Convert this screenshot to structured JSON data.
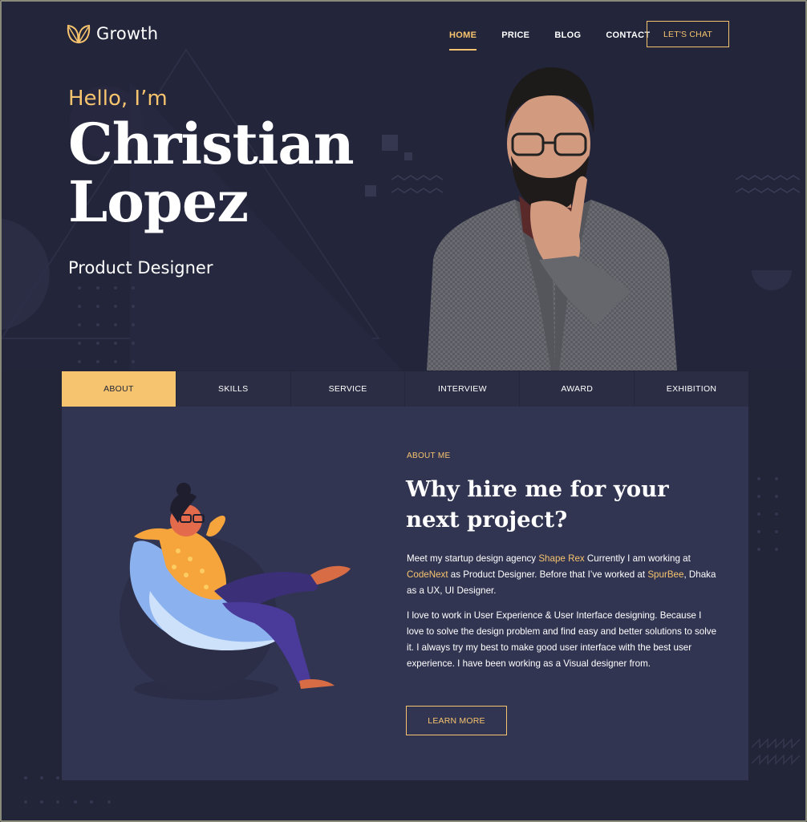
{
  "brand": {
    "logo_text": "Growth",
    "logo_icon": "leaf-icon",
    "accent_color": "#f6c46e",
    "background_color": "#222437",
    "panel_color": "#323552"
  },
  "nav": {
    "items": [
      {
        "label": "HOME",
        "active": true
      },
      {
        "label": "PRICE",
        "active": false
      },
      {
        "label": "BLOG",
        "active": false
      },
      {
        "label": "CONTACT",
        "active": false
      }
    ],
    "cta_label": "LET'S CHAT"
  },
  "hero": {
    "greeting": "Hello, I’m",
    "first_name": "Christian",
    "last_name": "Lopez",
    "role": "Product Designer",
    "portrait": "man-with-beard-portrait"
  },
  "tabs": [
    {
      "label": "ABOUT",
      "active": true
    },
    {
      "label": "SKILLS",
      "active": false
    },
    {
      "label": "SERVICE",
      "active": false
    },
    {
      "label": "INTERVIEW",
      "active": false
    },
    {
      "label": "AWARD",
      "active": false
    },
    {
      "label": "EXHIBITION",
      "active": false
    }
  ],
  "about": {
    "label": "ABOUT ME",
    "title": "Why hire me for your next project?",
    "para1": {
      "t1": "Meet my startup design agency ",
      "link1": "Shape Rex",
      "t2": " Currently I am working at ",
      "link2": "CodeNext",
      "t3": " as Product Designer. Before that I’ve worked at ",
      "link3": "SpurBee",
      "t4": ", Dhaka as a UX, UI Designer."
    },
    "para2": "I love to work in User Experience & User Interface designing. Because I love to solve the design problem and find easy and better solutions to solve it. I always try my best to make good user interface with the best user experience. I have been working as a Visual designer from.",
    "button_label": "LEARN MORE",
    "illustration": "relaxing-person-in-chair-illustration"
  }
}
